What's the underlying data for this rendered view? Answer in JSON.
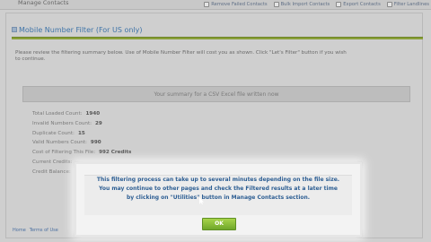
{
  "topbar": {
    "tab_label": "Manage Contacts",
    "links": [
      {
        "label": "Remove Failed Contacts",
        "icon": "remove-icon"
      },
      {
        "label": "Bulk Import Contacts",
        "icon": "import-icon"
      },
      {
        "label": "Export Contacts",
        "icon": "export-icon"
      },
      {
        "label": "Filter Landlines",
        "icon": "filter-icon"
      }
    ]
  },
  "page": {
    "title": "Mobile Number Filter (For US only)",
    "intro_lines": [
      "Please review the filtering summary below. Use of Mobile Number Filter will cost you as shown. Click \"Let's Filter\" button if you wish",
      "to continue."
    ]
  },
  "summary": {
    "title": "Your summary for a CSV Excel file written now",
    "rows": [
      {
        "label": "Total Loaded Count:",
        "value": "1940"
      },
      {
        "label": "Invalid Numbers Count:",
        "value": "29"
      },
      {
        "label": "Duplicate Count:",
        "value": "15"
      },
      {
        "label": "Valid Numbers Count:",
        "value": "990"
      },
      {
        "label": "Cost of Filtering This File:",
        "value": "992 Credits"
      },
      {
        "label": "Current Credits:",
        "value": ""
      },
      {
        "label": "Credit Balance:",
        "value": ""
      }
    ]
  },
  "footer": {
    "crumbs": [
      "Home",
      "Terms of Use"
    ]
  },
  "modal": {
    "lines": [
      "This filtering process can take up to several minutes depending on the file size.",
      "You may continue to other pages and check the Filtered results at a later time",
      "by clicking on \"Utilities\" button in Manage Contacts section."
    ],
    "ok_label": "OK"
  }
}
